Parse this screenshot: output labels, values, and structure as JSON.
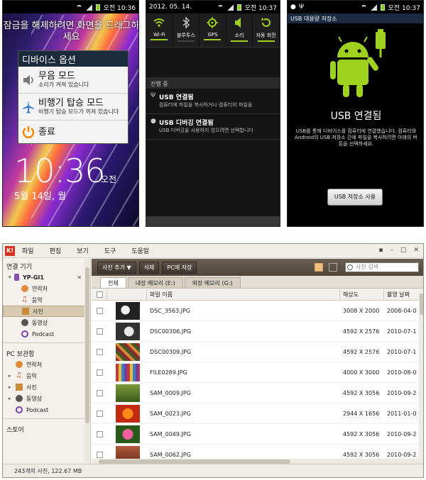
{
  "phone1": {
    "time": "오전 10:36",
    "hint": "잠금을 해제하려면 화면을 드래그하세요",
    "dialog_title": "디바이스 옵션",
    "options": [
      {
        "label": "무음 모드",
        "sub": "소리가 켜져 있습니다"
      },
      {
        "label": "비행기 탑승 모드",
        "sub": "비행기 탑승 모드가 꺼져 있습니다"
      },
      {
        "label": "종료",
        "sub": ""
      }
    ],
    "clock": "10:36",
    "ampm": "오전",
    "date": "5월 14일, 월"
  },
  "phone2": {
    "date": "2012. 05. 14.",
    "time": "오전 10:37",
    "toggles": [
      {
        "label": "Wi-Fi",
        "on": true
      },
      {
        "label": "블루투스",
        "on": false
      },
      {
        "label": "GPS",
        "on": true
      },
      {
        "label": "소리",
        "on": true
      },
      {
        "label": "자동 회전",
        "on": true
      }
    ],
    "section": "진행 중",
    "notifications": [
      {
        "title": "USB 연결됨",
        "sub": "컴퓨터에 파일을 복사하거나 컴퓨터의 파일을"
      },
      {
        "title": "USB 디버깅 연결됨",
        "sub": "USB 디버깅을 사용하지 않으려면 선택합니다"
      }
    ]
  },
  "phone3": {
    "time": "오전 10:37",
    "title": "USB 대용량 저장소",
    "heading": "USB 연결됨",
    "description": "USB를 통해 디바이스를 컴퓨터에 연결했습니다. 컴퓨터와 Android의 USB 저장소 간에 파일을 복사하려면 아래의 버튼을 선택하세요.",
    "button": "USB 저장소 사용"
  },
  "app": {
    "logo": "K!",
    "menu": [
      "파일",
      "편집",
      "보기",
      "도구",
      "도움말"
    ],
    "sidebar": {
      "connected_header": "연결 기기",
      "device": "YP-GI1",
      "device_items": [
        "연락처",
        "음악",
        "사진",
        "동영상",
        "Podcast"
      ],
      "pc_header": "PC 보관함",
      "pc_items": [
        "연락처",
        "음악",
        "사진",
        "동영상",
        "Podcast"
      ],
      "store_header": "스토어"
    },
    "toolbar": {
      "add_photo": "사진 추가 ▼",
      "delete": "삭제",
      "save_pc": "PC에 저장",
      "search_placeholder": "사진 검색"
    },
    "tabs": [
      "전체",
      "내장 메모리 (E:)",
      "외장 메모리 (G:)"
    ],
    "columns": [
      "파일 이름",
      "해상도",
      "촬영 날짜"
    ],
    "rows": [
      {
        "name": "DSC_3563.JPG",
        "res": "3008 X 2000",
        "date": "2008-04-0"
      },
      {
        "name": "DSC00306.JPG",
        "res": "4592 X 2576",
        "date": "2010-07-1"
      },
      {
        "name": "DSC00309.JPG",
        "res": "4592 X 2576",
        "date": "2010-07-1"
      },
      {
        "name": "FILE0289.JPG",
        "res": "4000 X 3000",
        "date": "2010-08-0"
      },
      {
        "name": "SAM_0009.JPG",
        "res": "4592 X 3056",
        "date": "2010-09-2"
      },
      {
        "name": "SAM_0023.JPG",
        "res": "2944 X 1656",
        "date": "2011-01-0"
      },
      {
        "name": "SAM_0049.JPG",
        "res": "4592 X 3056",
        "date": "2010-09-2"
      },
      {
        "name": "SAM_0062.JPG",
        "res": "4592 X 3056",
        "date": "2010-09-2"
      }
    ],
    "status": "243개의 사진, 122.67 MB"
  }
}
